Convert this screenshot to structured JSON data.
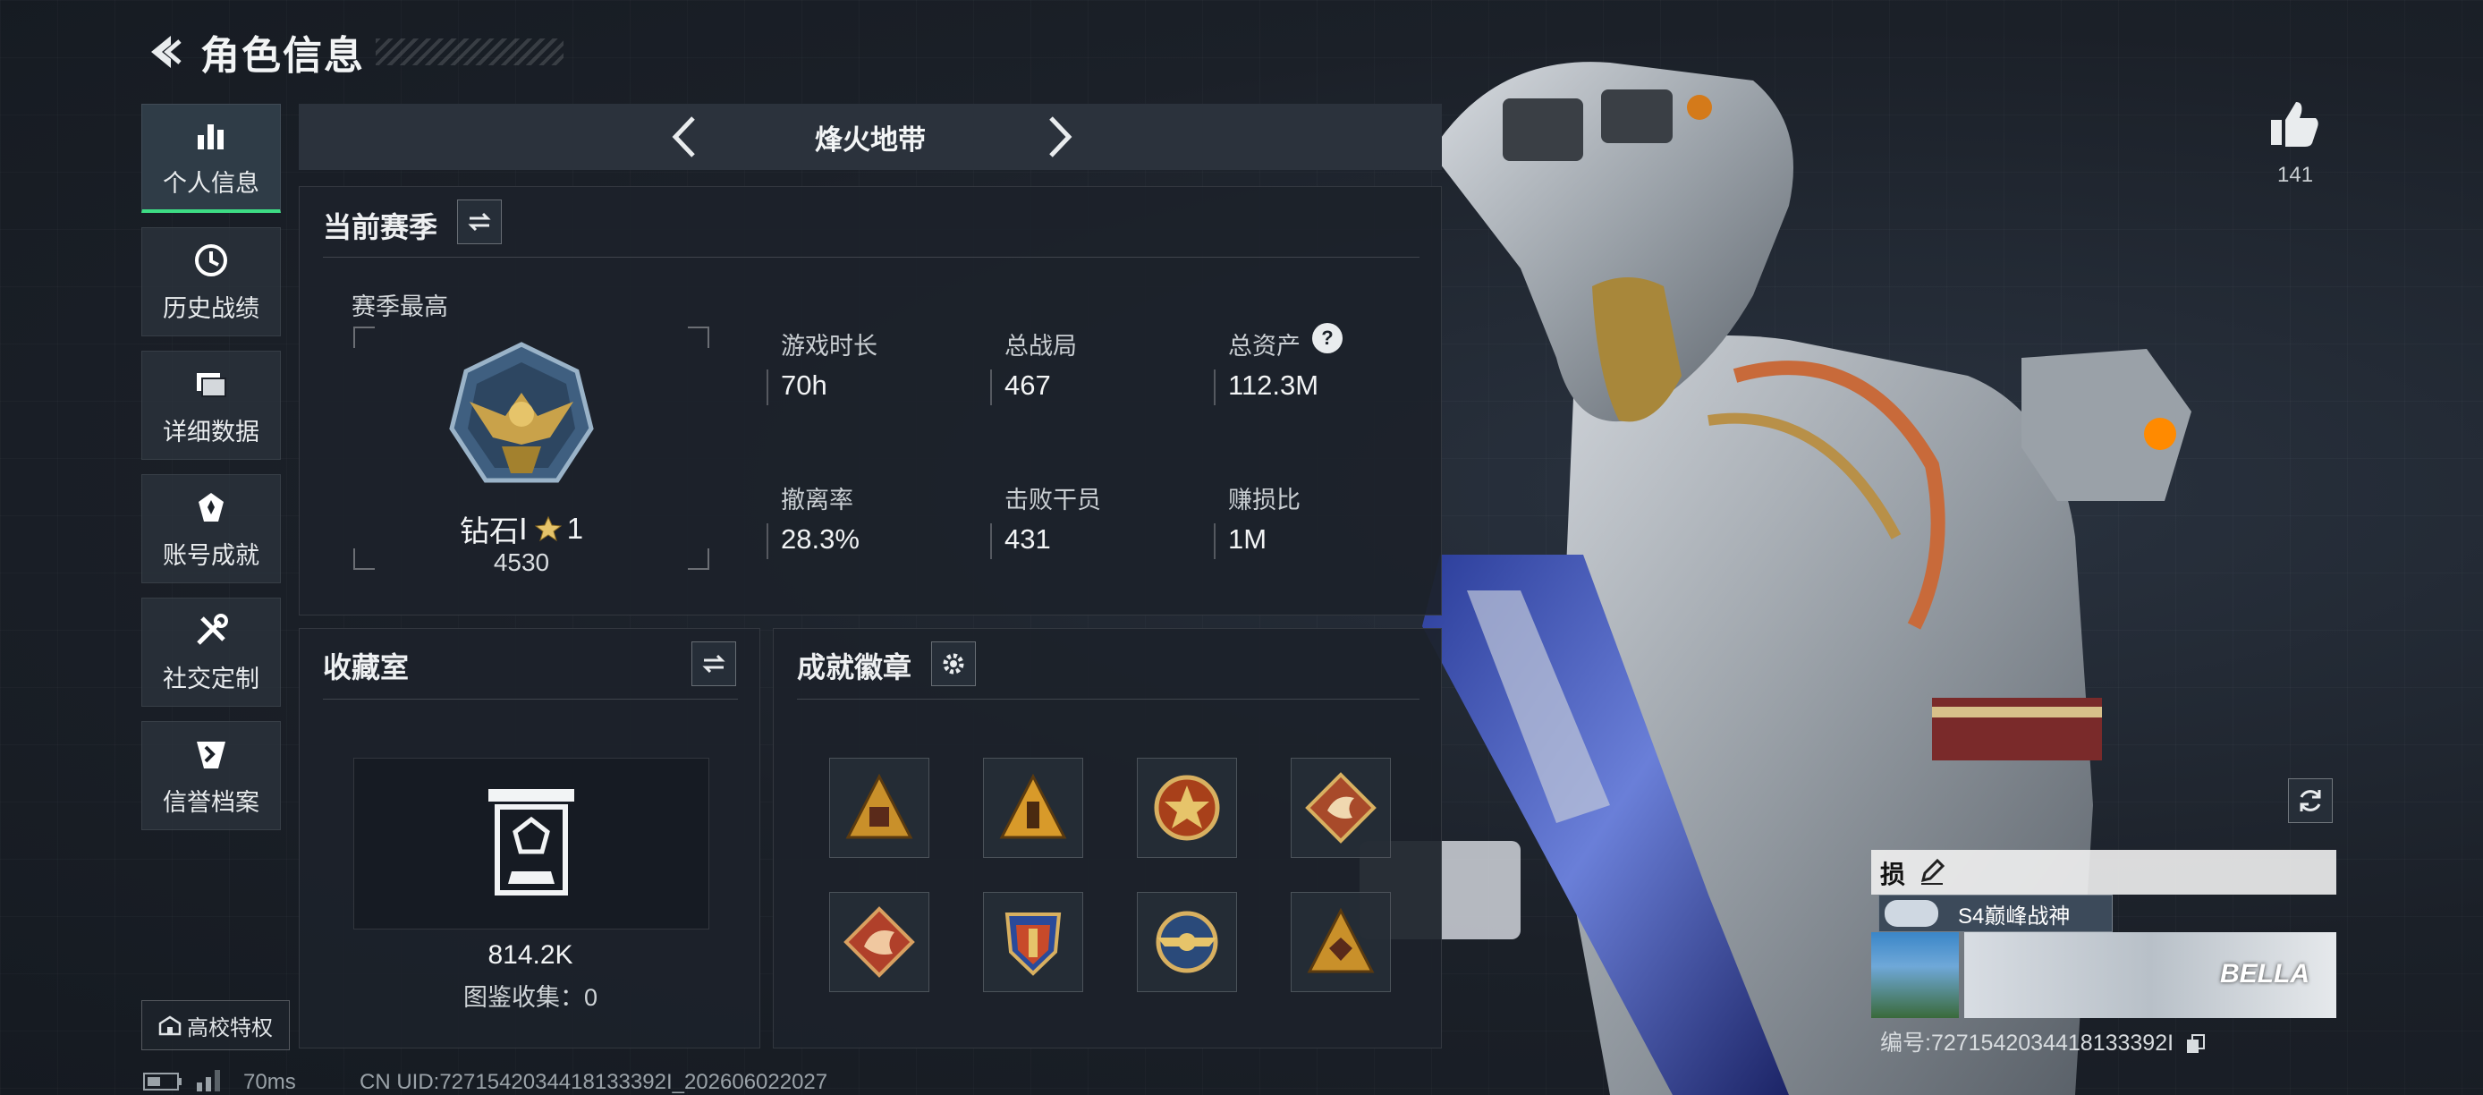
{
  "header": {
    "title": "角色信息"
  },
  "sidebar": {
    "items": [
      {
        "label": "个人信息",
        "icon": "bar-chart-icon",
        "active": true
      },
      {
        "label": "历史战绩",
        "icon": "clock-icon"
      },
      {
        "label": "详细数据",
        "icon": "folder-icon"
      },
      {
        "label": "账号成就",
        "icon": "trophy-icon"
      },
      {
        "label": "社交定制",
        "icon": "tools-icon"
      },
      {
        "label": "信誉档案",
        "icon": "shield-icon"
      }
    ],
    "campus_label": "高校特权"
  },
  "mode": {
    "title": "烽火地带"
  },
  "season": {
    "title": "当前赛季",
    "best_label": "赛季最高",
    "rank_name": "钻石",
    "rank_tier": "Ⅰ",
    "rank_stars": "1",
    "rank_points": "4530",
    "stats": [
      {
        "label": "游戏时长",
        "value": "70h"
      },
      {
        "label": "总战局",
        "value": "467"
      },
      {
        "label": "总资产",
        "value": "112.3M",
        "help": "?"
      },
      {
        "label": "撤离率",
        "value": "28.3%"
      },
      {
        "label": "击败干员",
        "value": "431"
      },
      {
        "label": "赚损比",
        "value": "1M"
      }
    ]
  },
  "collection": {
    "title": "收藏室",
    "value": "814.2K",
    "collect_label": "图鉴收集：",
    "collect_count": "0"
  },
  "badges": {
    "title": "成就徽章",
    "items": [
      "triangle-badge-icon",
      "triangle-badge-icon",
      "star-medal-icon",
      "dragon-badge-icon",
      "dragon-badge-icon",
      "shield-badge-icon",
      "wing-badge-icon",
      "triangle-badge-icon"
    ]
  },
  "status": {
    "ping": "70ms",
    "uid": "CN UID:7271542034418133392I_202606022027"
  },
  "profile": {
    "likes": "141",
    "sign": "损",
    "title_tag": "S4巅峰战神",
    "card_label": "BELLA",
    "id_line": "编号:7271542034418133392I"
  },
  "colors": {
    "accent": "#3ddc84",
    "panel": "#1c222a",
    "gold": "#c9a24a"
  }
}
